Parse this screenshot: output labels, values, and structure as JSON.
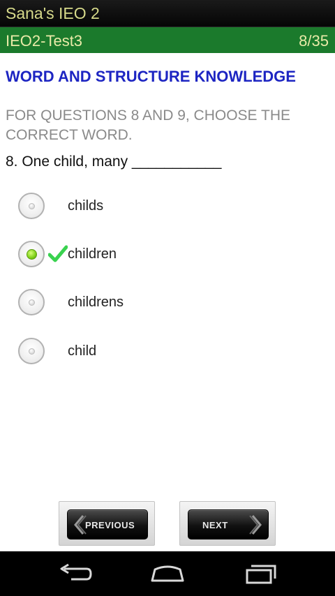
{
  "app": {
    "title": "Sana's IEO 2"
  },
  "test": {
    "name": "IEO2-Test3",
    "progress": "8/35"
  },
  "section": {
    "title": "WORD AND STRUCTURE KNOWLEDGE",
    "instruction": "FOR QUESTIONS 8 AND 9, CHOOSE THE CORRECT WORD."
  },
  "question": {
    "text": "8. One child, many ___________"
  },
  "options": [
    {
      "label": "childs",
      "selected": false
    },
    {
      "label": "children",
      "selected": true,
      "marked_correct": true
    },
    {
      "label": "childrens",
      "selected": false
    },
    {
      "label": "child",
      "selected": false
    }
  ],
  "buttons": {
    "previous": "PREVIOUS",
    "next": "NEXT"
  },
  "system_nav": {
    "back": "back-icon",
    "home": "home-icon",
    "recents": "recents-icon"
  },
  "colors": {
    "title_text": "#d6d98a",
    "sub_bar": "#1b7a2c",
    "section_title": "#1d25c2",
    "instruction": "#8a8a8a",
    "check": "#39d24f",
    "selected_radio": "#7ecf17"
  }
}
